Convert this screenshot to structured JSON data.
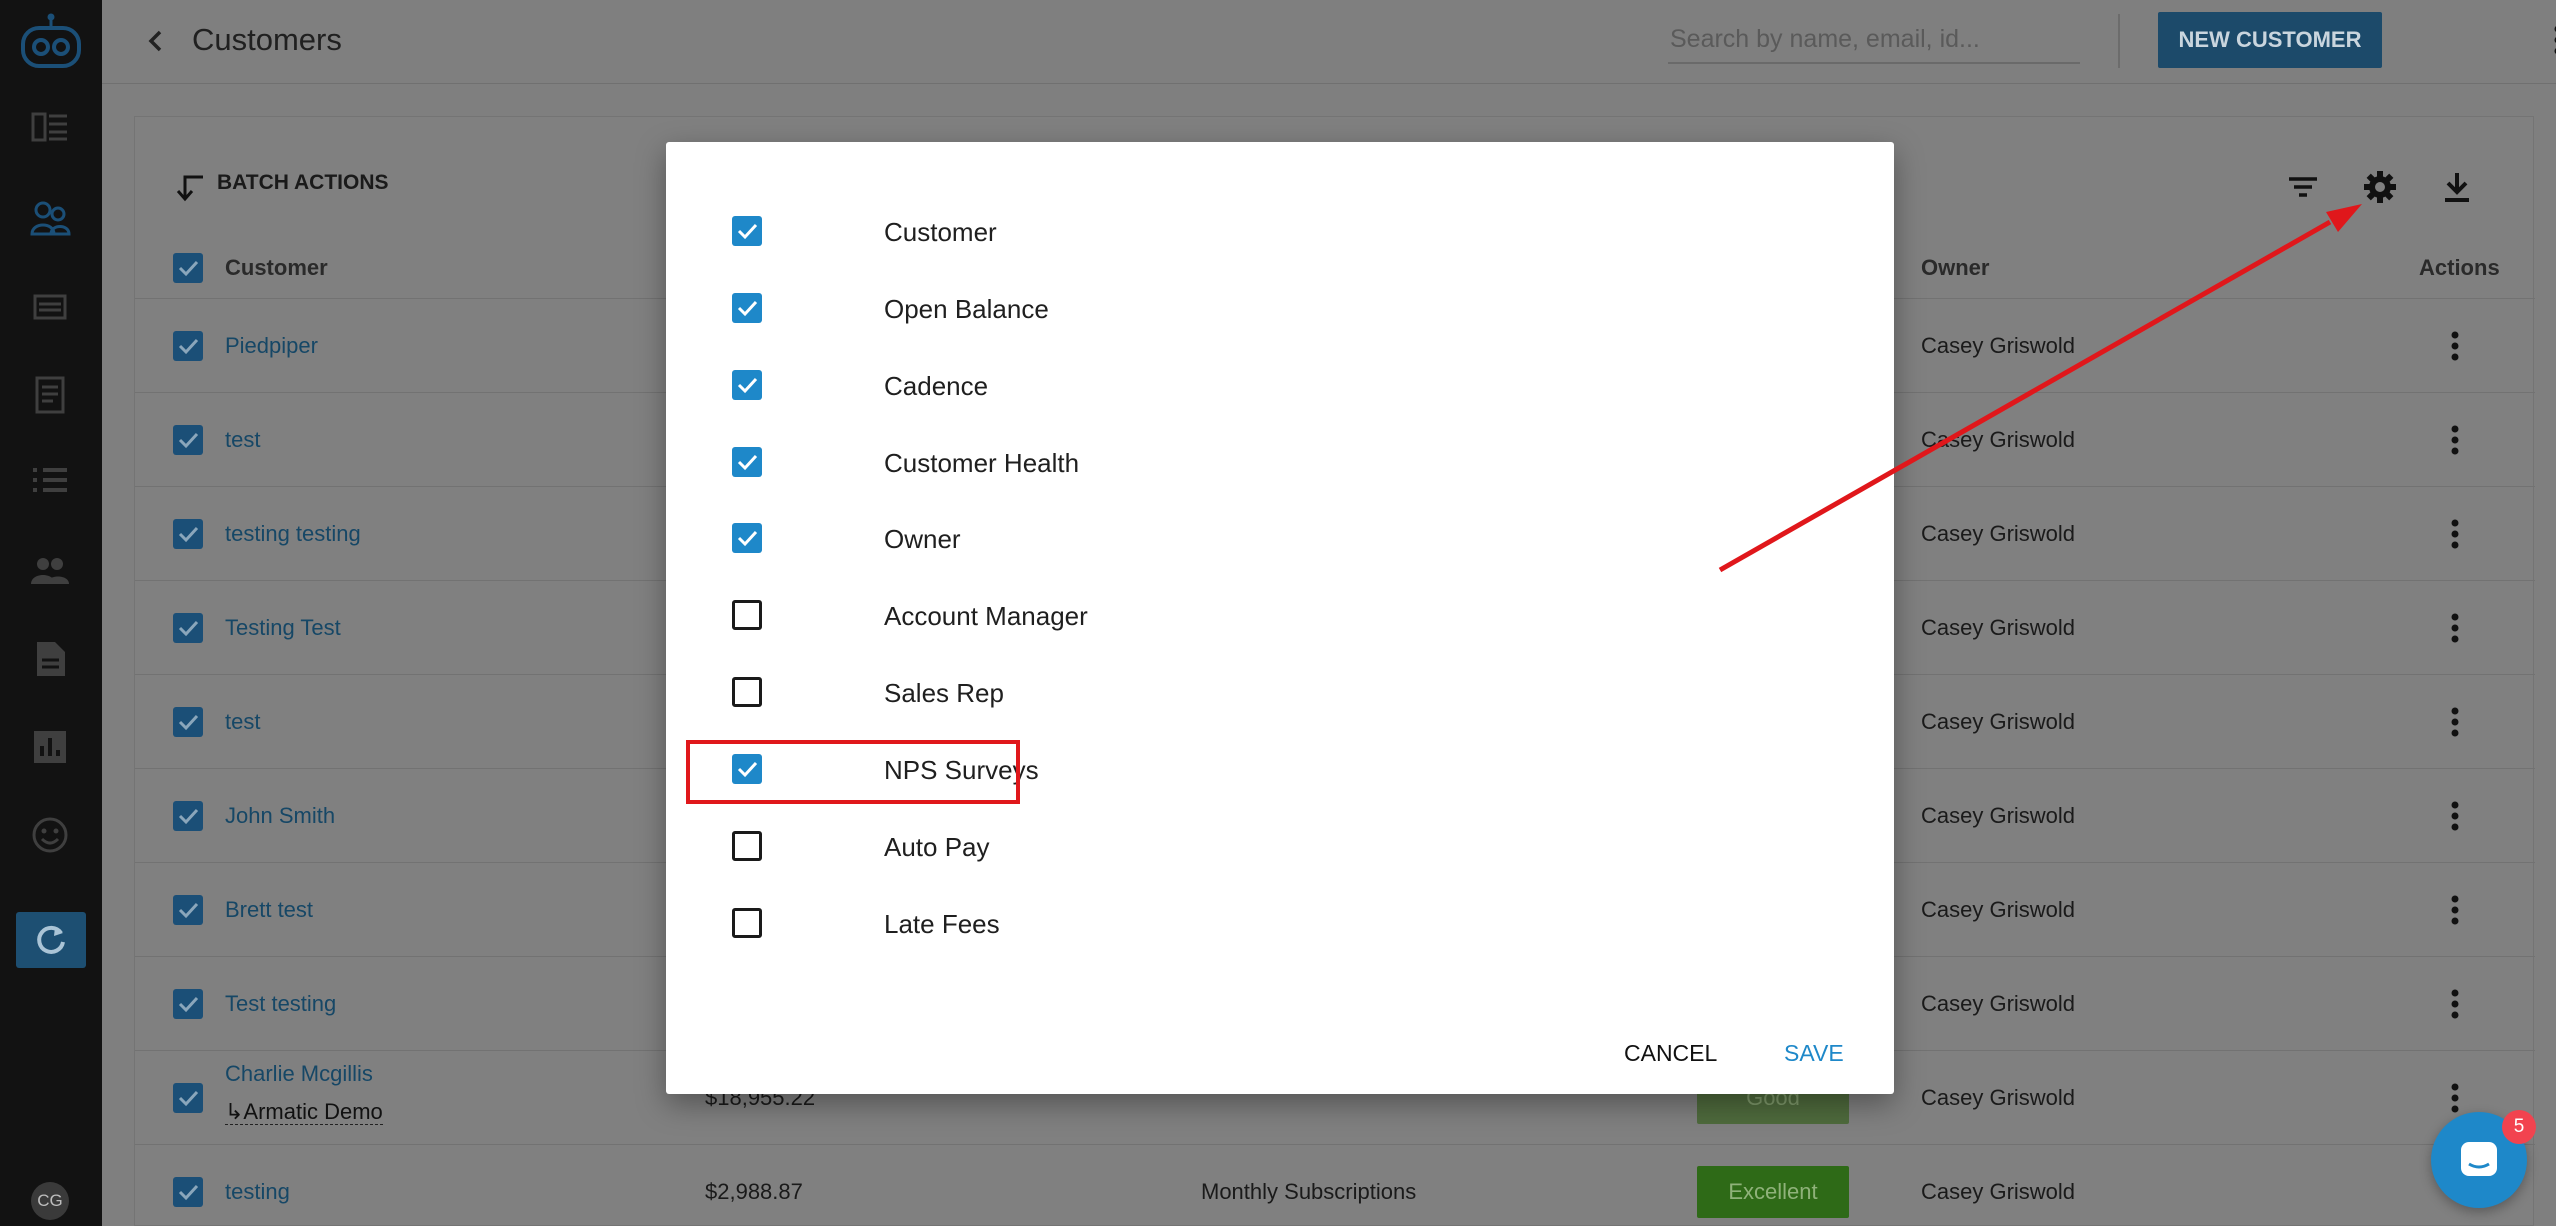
{
  "sidebar": {
    "avatar_initials": "CG"
  },
  "header": {
    "title": "Customers",
    "search_placeholder": "Search by name, email, id...",
    "new_button_label": "NEW CUSTOMER"
  },
  "toolbar": {
    "batch_actions_label": "BATCH ACTIONS"
  },
  "table": {
    "columns": {
      "customer": "Customer",
      "owner": "Owner",
      "actions": "Actions"
    },
    "rows": [
      {
        "name": "Piedpiper",
        "owner": "Casey Griswold"
      },
      {
        "name": "test",
        "owner": "Casey Griswold"
      },
      {
        "name": "testing testing",
        "owner": "Casey Griswold"
      },
      {
        "name": "Testing Test",
        "owner": "Casey Griswold"
      },
      {
        "name": "test",
        "owner": "Casey Griswold"
      },
      {
        "name": "John Smith",
        "owner": "Casey Griswold"
      },
      {
        "name": "Brett test",
        "owner": "Casey Griswold"
      },
      {
        "name": "Test testing",
        "owner": "Casey Griswold"
      },
      {
        "name": "Charlie Mcgillis",
        "parent": "↳Armatic Demo",
        "balance": "$18,955.22",
        "health": "Good",
        "owner": "Casey Griswold"
      },
      {
        "name": "testing",
        "balance": "$2,988.87",
        "cadence": "Monthly Subscriptions",
        "health": "Excellent",
        "owner": "Casey Griswold"
      }
    ]
  },
  "dialog": {
    "options": [
      {
        "label": "Customer",
        "checked": true
      },
      {
        "label": "Open Balance",
        "checked": true
      },
      {
        "label": "Cadence",
        "checked": true
      },
      {
        "label": "Customer Health",
        "checked": true
      },
      {
        "label": "Owner",
        "checked": true
      },
      {
        "label": "Account Manager",
        "checked": false
      },
      {
        "label": "Sales Rep",
        "checked": false
      },
      {
        "label": "NPS Surveys",
        "checked": true
      },
      {
        "label": "Auto Pay",
        "checked": false
      },
      {
        "label": "Late Fees",
        "checked": false
      }
    ],
    "cancel_label": "CANCEL",
    "save_label": "SAVE"
  },
  "chat": {
    "badge_count": "5"
  },
  "colors": {
    "accent": "#1e88c9",
    "annotation": "#e0171b",
    "health_good": "#8fbf6a",
    "health_excellent": "#2e7d1a"
  }
}
